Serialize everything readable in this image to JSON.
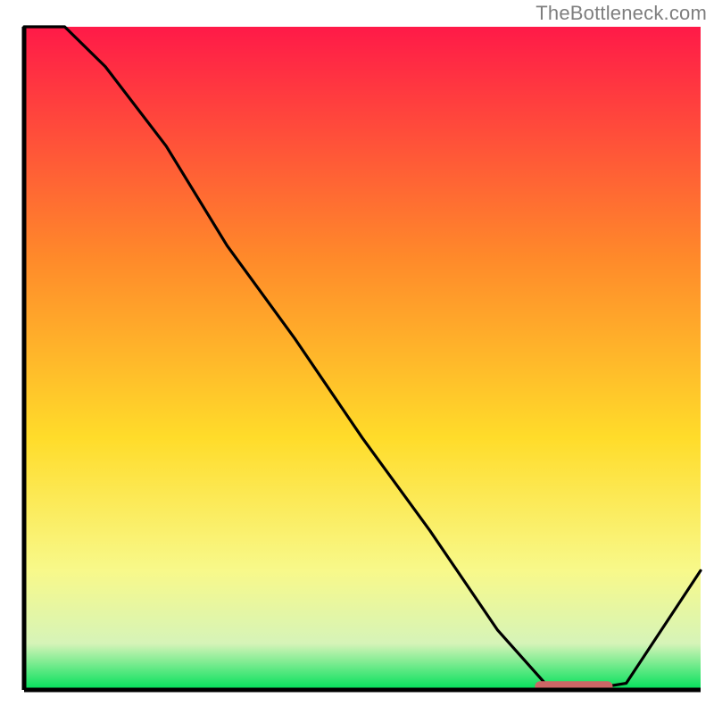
{
  "attribution": "TheBottleneck.com",
  "chart_data": {
    "type": "line",
    "x": [
      0.0,
      0.06,
      0.12,
      0.21,
      0.3,
      0.4,
      0.5,
      0.6,
      0.7,
      0.77,
      0.83,
      0.89,
      1.0
    ],
    "y": [
      1.1,
      1.02,
      0.94,
      0.82,
      0.67,
      0.53,
      0.38,
      0.24,
      0.09,
      0.01,
      0.0,
      0.01,
      0.18
    ],
    "xlim": [
      0,
      1
    ],
    "ylim": [
      0,
      1
    ],
    "title": "",
    "xlabel": "",
    "ylabel": "",
    "marker": {
      "x_start": 0.755,
      "x_end": 0.87,
      "y": 0.005
    },
    "colors": {
      "gradient_top": "#ff1a48",
      "gradient_mid_upper": "#ff8a2a",
      "gradient_mid": "#ffdc2a",
      "gradient_lower": "#f8f98a",
      "gradient_band": "#d6f4b8",
      "gradient_bottom": "#00e05a",
      "line": "#000000",
      "axis": "#000000",
      "marker": "#cc6666"
    }
  }
}
